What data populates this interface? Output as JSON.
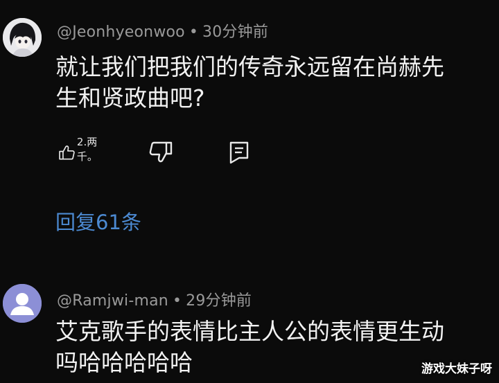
{
  "comments": [
    {
      "author": "@Jeonhyeonwoo",
      "time": "30分钟前",
      "text": "就让我们把我们的传奇永远留在尚赫先\n生和贤政曲吧?",
      "like_count": "2.两千。",
      "replies_label": "回复61条",
      "avatar_icon": "anime-character-avatar-icon"
    },
    {
      "author": "@Ramjwi-man",
      "time": "29分钟前",
      "text": "艾克歌手的表情比主人公的表情更生动\n吗哈哈哈哈哈",
      "avatar_icon": "default-user-avatar-icon"
    }
  ],
  "separator": "•",
  "icons": {
    "like": "thumbs-up-icon",
    "dislike": "thumbs-down-icon",
    "reply": "comment-reply-icon"
  },
  "watermark": "游戏大妹子呀",
  "colors": {
    "background": "#0b0b0b",
    "text": "#f2f2f2",
    "meta": "#9a9a9a",
    "link": "#4c8ad2",
    "avatar_default": "#8c8fd6"
  }
}
